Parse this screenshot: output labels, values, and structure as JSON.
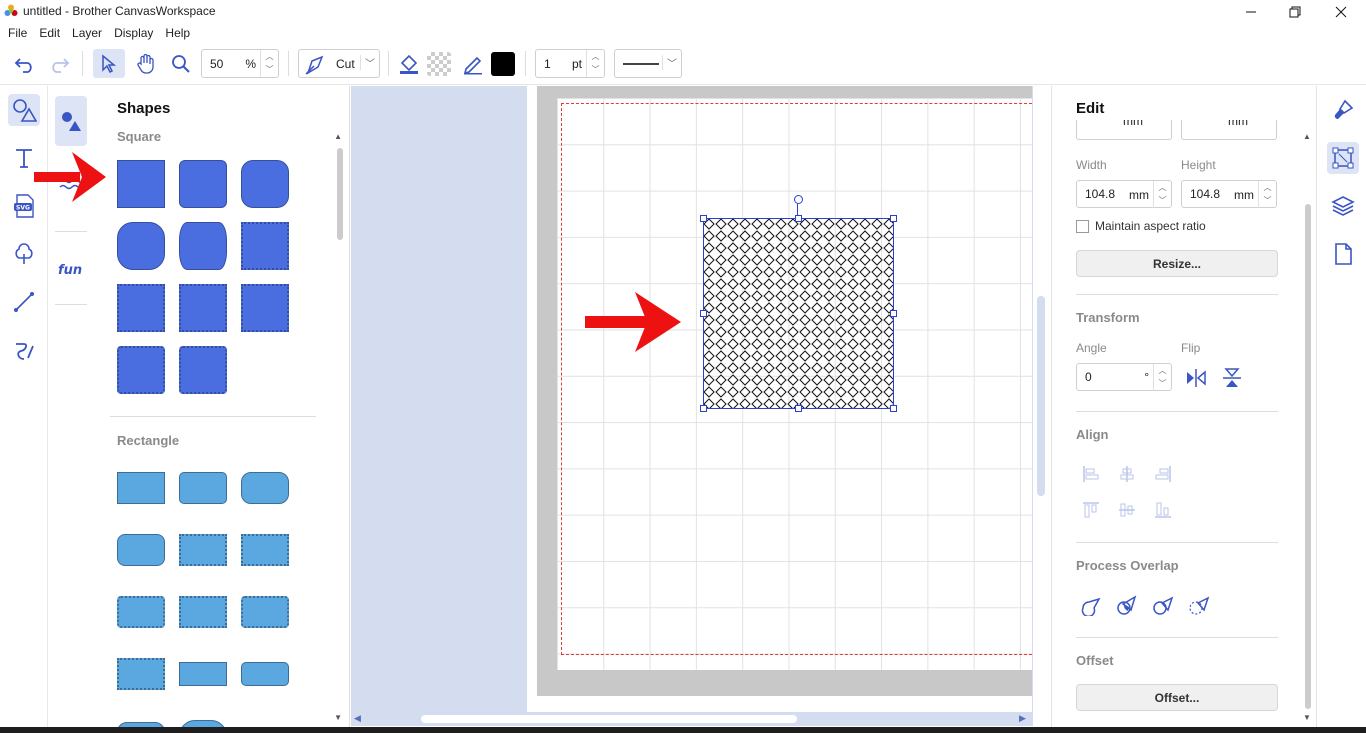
{
  "window": {
    "title": "untitled - Brother CanvasWorkspace"
  },
  "menu": [
    "File",
    "Edit",
    "Layer",
    "Display",
    "Help"
  ],
  "toolbar": {
    "zoom_value": "50",
    "zoom_unit": "%",
    "mode_label": "Cut",
    "line_width_value": "1",
    "line_width_unit": "pt",
    "stroke_color": "#000000"
  },
  "shapes_panel": {
    "title": "Shapes",
    "section_square": "Square",
    "section_rectangle": "Rectangle",
    "square_color": "#4a6ee0",
    "rect_color": "#5ba7e0"
  },
  "edit_panel": {
    "title": "Edit",
    "top_partial_unit_1": "mm",
    "top_partial_unit_2": "mm",
    "width_label": "Width",
    "height_label": "Height",
    "width_value": "104.8",
    "width_unit": "mm",
    "height_value": "104.8",
    "height_unit": "mm",
    "maintain_aspect_label": "Maintain aspect ratio",
    "resize_button": "Resize...",
    "transform_title": "Transform",
    "angle_label": "Angle",
    "angle_value": "0",
    "angle_unit": "°",
    "flip_label": "Flip",
    "align_title": "Align",
    "process_overlap_title": "Process Overlap",
    "offset_title": "Offset",
    "offset_button": "Offset..."
  },
  "colors": {
    "accent": "#2b3fd1",
    "canvas_bg": "#d4dcef",
    "annotation_arrow": "#ee1111"
  }
}
